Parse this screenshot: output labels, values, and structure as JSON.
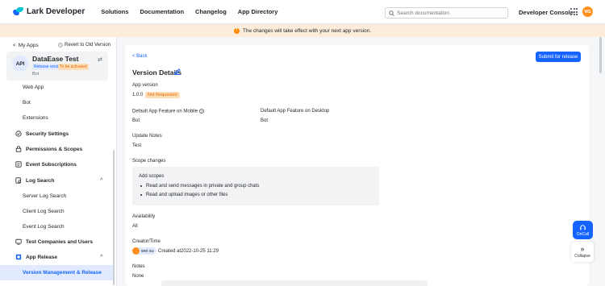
{
  "header": {
    "logo_text": "Lark Developer",
    "nav": [
      "Solutions",
      "Documentation",
      "Changelog",
      "App Directory"
    ],
    "search_placeholder": "Search documentation",
    "developer_console": "Developer Console",
    "avatar_initials": "WS"
  },
  "notice": {
    "text": "The changes will take effect with your next app version."
  },
  "sidebar": {
    "my_apps": "My Apps",
    "revert": "Revert to Old Version",
    "app": {
      "icon_text": "API",
      "name": "DataEase Test",
      "badge_release": "Release version",
      "badge_status": "To be activated",
      "type": "Bot"
    },
    "items": [
      {
        "label": "Web App"
      },
      {
        "label": "Bot"
      },
      {
        "label": "Extensions"
      },
      {
        "label": "Security Settings"
      },
      {
        "label": "Permissions & Scopes"
      },
      {
        "label": "Event Subscriptions"
      },
      {
        "label": "Log Search"
      },
      {
        "label": "Server Log Search"
      },
      {
        "label": "Client Log Search"
      },
      {
        "label": "Event Log Search"
      },
      {
        "label": "Test Companies and Users"
      },
      {
        "label": "App Release"
      },
      {
        "label": "Version Management & Release"
      }
    ]
  },
  "main": {
    "back": "Back",
    "submit": "Submit for release",
    "title": "Version Details",
    "app_version_label": "App version",
    "app_version": "1.0.0",
    "version_status": "Not Requested",
    "mobile_label": "Default App Feature on Mobile",
    "mobile_value": "Bot",
    "desktop_label": "Default App Feature on Desktop",
    "desktop_value": "Bot",
    "update_notes_label": "Update Notes",
    "update_notes": "Test",
    "scope_changes_label": "Scope changes",
    "add_scopes": "Add scopes",
    "scopes": [
      "Read and send messages in private and group chats",
      "Read and upload images or other files"
    ],
    "availability_label": "Availability",
    "availability": "All",
    "creator_label": "Creator/Time",
    "creator_name": "wei su",
    "created_at": "Created at2022-10-25 11:29",
    "notes_label": "Notes",
    "notes": "None"
  },
  "floating": {
    "oncall": "OnCall",
    "collapse": "Collapse"
  },
  "colors": {
    "brand": "#1664ff",
    "warning": "#e76b00",
    "notice_bg": "#fcecd9"
  }
}
